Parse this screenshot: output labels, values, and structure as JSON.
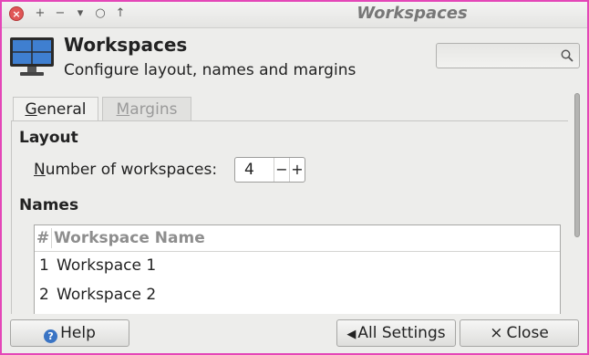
{
  "window": {
    "title": "Workspaces"
  },
  "titlebar": {
    "close_glyph": "×",
    "plus_glyph": "+",
    "minus_glyph": "−",
    "down_glyph": "▾",
    "circle_glyph": "○",
    "up_glyph": "↑"
  },
  "header": {
    "title": "Workspaces",
    "subtitle": "Configure layout, names and margins",
    "search_placeholder": ""
  },
  "tabs": [
    {
      "mnemonic": "G",
      "rest": "eneral",
      "active": true
    },
    {
      "mnemonic": "M",
      "rest": "argins",
      "active": false
    }
  ],
  "layout": {
    "heading": "Layout",
    "num_label_mnemonic": "N",
    "num_label_rest": "umber of workspaces:",
    "num_value": "4",
    "minus": "−",
    "plus": "+"
  },
  "names": {
    "heading": "Names",
    "columns": [
      "#",
      "Workspace Name"
    ],
    "rows": [
      {
        "num": "1",
        "name": "Workspace 1"
      },
      {
        "num": "2",
        "name": "Workspace 2"
      }
    ]
  },
  "footer": {
    "help": "Help",
    "all_settings": "All Settings",
    "close": "Close",
    "help_glyph": "?",
    "back_glyph": "◀",
    "close_glyph": "×"
  },
  "icons": [
    "close-icon",
    "plus-icon",
    "minus-icon",
    "chevron-down-icon",
    "circle-icon",
    "arrow-up-icon",
    "monitor-icon",
    "search-icon",
    "help-icon",
    "back-icon"
  ],
  "colors": {
    "window_border": "#e447b8",
    "close_button": "#e05656",
    "help_icon": "#3a74c4"
  }
}
